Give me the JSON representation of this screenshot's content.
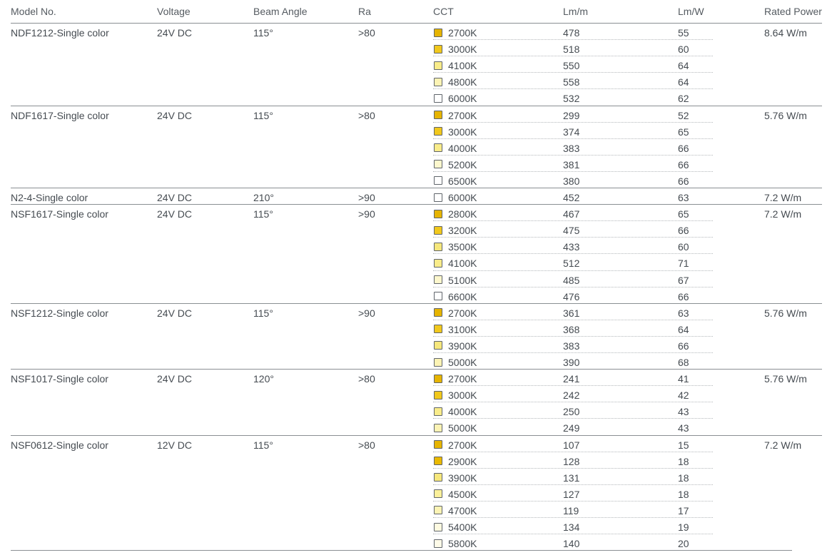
{
  "columns": {
    "model": "Model No.",
    "voltage": "Voltage",
    "beam_angle": "Beam Angle",
    "ra": "Ra",
    "cct": "CCT",
    "lm_m": "Lm/m",
    "lm_w": "Lm/W",
    "rated_power": "Rated Power"
  },
  "cct_colors": {
    "2700K": "#e6b400",
    "2800K": "#e6b400",
    "2900K": "#eab900",
    "3000K": "#f1c81c",
    "3100K": "#f1c81c",
    "3200K": "#f1c81c",
    "3500K": "#f6e77c",
    "3900K": "#f6e77c",
    "4000K": "#f9ec8a",
    "4100K": "#f9ec8a",
    "4500K": "#fbf09a",
    "4700K": "#fcf3b4",
    "4800K": "#fcf3b4",
    "5000K": "#fcf3b4",
    "5100K": "#fdf7cd",
    "5200K": "#fdf7cd",
    "5400K": "#fefae0",
    "5800K": "#fefbe8",
    "6000K": "#ffffff",
    "6500K": "#ffffff",
    "6600K": "#ffffff"
  },
  "products": [
    {
      "model": "NDF1212-Single color",
      "voltage": "24V DC",
      "beam_angle": "115°",
      "ra": ">80",
      "rated_power": "8.64 W/m",
      "variants": [
        {
          "cct": "2700K",
          "lm_m": "478",
          "lm_w": "55"
        },
        {
          "cct": "3000K",
          "lm_m": "518",
          "lm_w": "60"
        },
        {
          "cct": "4100K",
          "lm_m": "550",
          "lm_w": "64"
        },
        {
          "cct": "4800K",
          "lm_m": "558",
          "lm_w": "64"
        },
        {
          "cct": "6000K",
          "lm_m": "532",
          "lm_w": "62"
        }
      ]
    },
    {
      "model": "NDF1617-Single color",
      "voltage": "24V DC",
      "beam_angle": "115°",
      "ra": ">80",
      "rated_power": "5.76 W/m",
      "variants": [
        {
          "cct": "2700K",
          "lm_m": "299",
          "lm_w": "52"
        },
        {
          "cct": "3000K",
          "lm_m": "374",
          "lm_w": "65"
        },
        {
          "cct": "4000K",
          "lm_m": "383",
          "lm_w": "66"
        },
        {
          "cct": "5200K",
          "lm_m": "381",
          "lm_w": "66"
        },
        {
          "cct": "6500K",
          "lm_m": "380",
          "lm_w": "66"
        }
      ]
    },
    {
      "model": "N2-4-Single color",
      "voltage": "24V DC",
      "beam_angle": "210°",
      "ra": ">90",
      "rated_power": "7.2 W/m",
      "variants": [
        {
          "cct": "6000K",
          "lm_m": "452",
          "lm_w": "63"
        }
      ]
    },
    {
      "model": "NSF1617-Single color",
      "voltage": "24V DC",
      "beam_angle": "115°",
      "ra": ">90",
      "rated_power": "7.2 W/m",
      "variants": [
        {
          "cct": "2800K",
          "lm_m": "467",
          "lm_w": "65"
        },
        {
          "cct": "3200K",
          "lm_m": "475",
          "lm_w": "66"
        },
        {
          "cct": "3500K",
          "lm_m": "433",
          "lm_w": "60"
        },
        {
          "cct": "4100K",
          "lm_m": "512",
          "lm_w": "71"
        },
        {
          "cct": "5100K",
          "lm_m": "485",
          "lm_w": "67"
        },
        {
          "cct": "6600K",
          "lm_m": "476",
          "lm_w": "66"
        }
      ]
    },
    {
      "model": "NSF1212-Single color",
      "voltage": "24V DC",
      "beam_angle": "115°",
      "ra": ">90",
      "rated_power": "5.76 W/m",
      "variants": [
        {
          "cct": "2700K",
          "lm_m": "361",
          "lm_w": "63"
        },
        {
          "cct": "3100K",
          "lm_m": "368",
          "lm_w": "64"
        },
        {
          "cct": "3900K",
          "lm_m": "383",
          "lm_w": "66"
        },
        {
          "cct": "5000K",
          "lm_m": "390",
          "lm_w": "68"
        }
      ]
    },
    {
      "model": "NSF1017-Single color",
      "voltage": "24V DC",
      "beam_angle": "120°",
      "ra": ">80",
      "rated_power": "5.76 W/m",
      "variants": [
        {
          "cct": "2700K",
          "lm_m": "241",
          "lm_w": "41"
        },
        {
          "cct": "3000K",
          "lm_m": "242",
          "lm_w": "42"
        },
        {
          "cct": "4000K",
          "lm_m": "250",
          "lm_w": "43"
        },
        {
          "cct": "5000K",
          "lm_m": "249",
          "lm_w": "43"
        }
      ]
    },
    {
      "model": "NSF0612-Single color",
      "voltage": "12V DC",
      "beam_angle": "115°",
      "ra": ">80",
      "rated_power": "7.2 W/m",
      "variants": [
        {
          "cct": "2700K",
          "lm_m": "107",
          "lm_w": "15"
        },
        {
          "cct": "2900K",
          "lm_m": "128",
          "lm_w": "18"
        },
        {
          "cct": "3900K",
          "lm_m": "131",
          "lm_w": "18"
        },
        {
          "cct": "4500K",
          "lm_m": "127",
          "lm_w": "18"
        },
        {
          "cct": "4700K",
          "lm_m": "119",
          "lm_w": "17"
        },
        {
          "cct": "5400K",
          "lm_m": "134",
          "lm_w": "19"
        },
        {
          "cct": "5800K",
          "lm_m": "140",
          "lm_w": "20"
        }
      ]
    }
  ]
}
